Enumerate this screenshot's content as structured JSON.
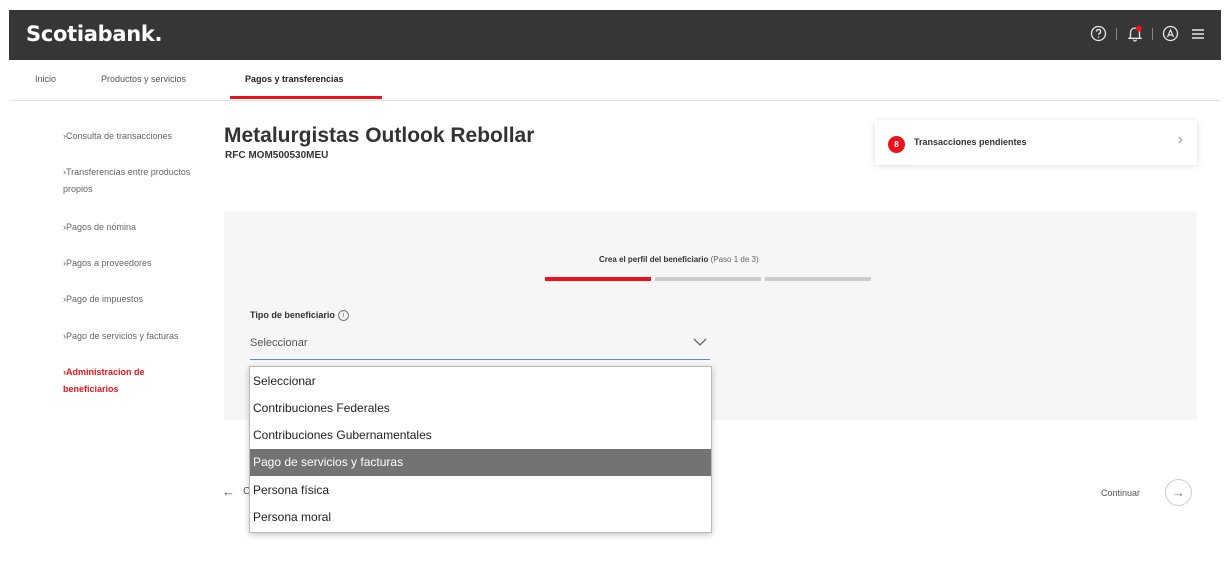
{
  "header": {
    "brand": "Scotiabank.",
    "icons": [
      "help-icon",
      "notification-bell-icon",
      "user-icon",
      "menu-icon"
    ]
  },
  "nav": {
    "tabs": [
      {
        "label": "Inicio"
      },
      {
        "label": "Productos y servicios"
      },
      {
        "label": "Pagos y transferencias",
        "active": true
      }
    ]
  },
  "sidebar": {
    "items": [
      {
        "label": "Consulta de transacciones"
      },
      {
        "label": "Transferencias entre productos propios"
      },
      {
        "label": "Pagos de nómina"
      },
      {
        "label": "Pagos a proveedores"
      },
      {
        "label": "Pago de impuestos"
      },
      {
        "label": "Pago de servicios y facturas"
      },
      {
        "label": "Administracion de beneficiarios",
        "active": true
      }
    ]
  },
  "page": {
    "title": "Metalurgistas Outlook Rebollar",
    "rfc": "RFC MOM500530MEU"
  },
  "pending": {
    "count": "8",
    "label": "Transacciones pendientes"
  },
  "stepper": {
    "label": "Crea el perfil del beneficiario",
    "sub": "(Paso 1 de 3)",
    "current_step": 1,
    "total_steps": 3,
    "colors": {
      "active": "#ec111a",
      "inactive": "#cccccc"
    }
  },
  "form": {
    "field_label": "Tipo de beneficiario",
    "selected": "Seleccionar",
    "options": [
      "Seleccionar",
      "Contribuciones Federales",
      "Contribuciones Gubernamentales",
      "Pago de servicios y facturas",
      "Persona física",
      "Persona moral"
    ],
    "highlighted_index": 3
  },
  "footer": {
    "back_label": "C",
    "continue_label": "Continuar"
  },
  "colors": {
    "brand_red": "#ec111a",
    "header_bg": "#363636",
    "highlight": "#737373"
  }
}
